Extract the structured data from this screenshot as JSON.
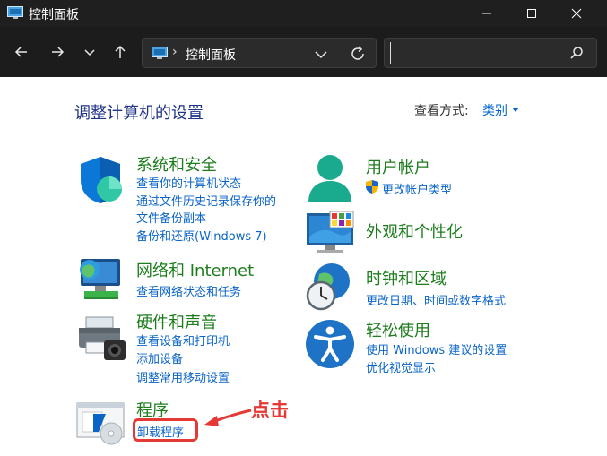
{
  "window": {
    "title": "控制面板",
    "controls": {
      "minimize": "—",
      "maximize": "☐",
      "close": "✕"
    }
  },
  "navbar": {
    "breadcrumb_separator": "›",
    "breadcrumb": "控制面板",
    "search_placeholder": ""
  },
  "main": {
    "heading": "调整计算机的设置",
    "view_by_label": "查看方式:",
    "view_by_value": "类别"
  },
  "categories": [
    {
      "title": "系统和安全",
      "links": [
        "查看你的计算机状态",
        "通过文件历史记录保存你的",
        "文件备份副本",
        "备份和还原(Windows 7)"
      ]
    },
    {
      "title": "网络和 Internet",
      "links": [
        "查看网络状态和任务"
      ]
    },
    {
      "title": "硬件和声音",
      "links": [
        "查看设备和打印机",
        "添加设备",
        "调整常用移动设置"
      ]
    },
    {
      "title": "程序",
      "links": [
        "卸载程序"
      ]
    },
    {
      "title": "用户帐户",
      "links": [
        "更改帐户类型"
      ]
    },
    {
      "title": "外观和个性化",
      "links": []
    },
    {
      "title": "时钟和区域",
      "links": [
        "更改日期、时间或数字格式"
      ]
    },
    {
      "title": "轻松使用",
      "links": [
        "使用 Windows 建议的设置",
        "优化视觉显示"
      ]
    }
  ],
  "annotation": {
    "text": "点击"
  },
  "colors": {
    "title_green": "#1d7d1d",
    "link_blue": "#0a64c8",
    "heading_blue": "#1e3287",
    "annotation_red": "#e53935"
  }
}
